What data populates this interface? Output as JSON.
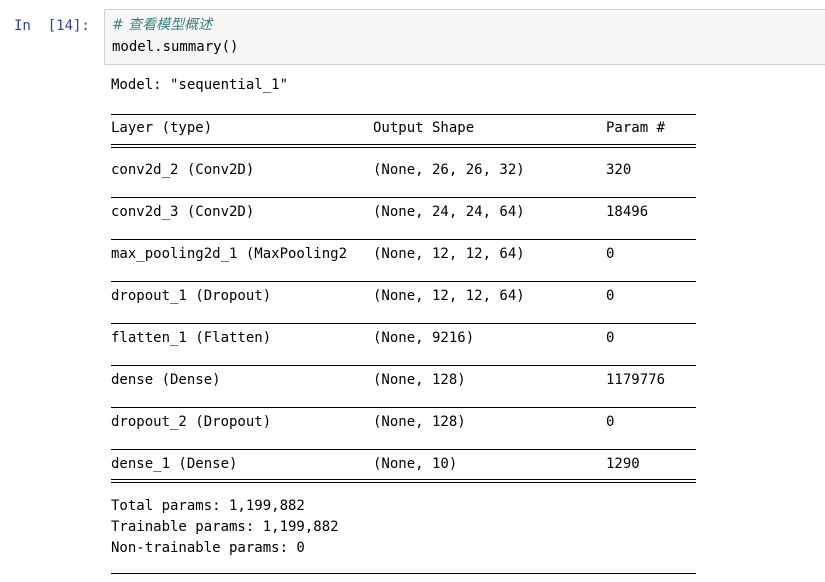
{
  "cell": {
    "prompt": "In  [14]:",
    "code_comment": "# 查看模型概述",
    "code_line": "model.summary()"
  },
  "output": {
    "model_title": "Model: \"sequential_1\"",
    "header": {
      "layer": "Layer (type)",
      "shape": "Output Shape",
      "param": "Param #"
    },
    "rows": [
      {
        "layer": "conv2d_2 (Conv2D)",
        "shape": "(None, 26, 26, 32)",
        "param": "320"
      },
      {
        "layer": "conv2d_3 (Conv2D)",
        "shape": "(None, 24, 24, 64)",
        "param": "18496"
      },
      {
        "layer": "max_pooling2d_1 (MaxPooling2",
        "shape": "(None, 12, 12, 64)",
        "param": "0"
      },
      {
        "layer": "dropout_1 (Dropout)",
        "shape": "(None, 12, 12, 64)",
        "param": "0"
      },
      {
        "layer": "flatten_1 (Flatten)",
        "shape": "(None, 9216)",
        "param": "0"
      },
      {
        "layer": "dense (Dense)",
        "shape": "(None, 128)",
        "param": "1179776"
      },
      {
        "layer": "dropout_2 (Dropout)",
        "shape": "(None, 128)",
        "param": "0"
      },
      {
        "layer": "dense_1 (Dense)",
        "shape": "(None, 10)",
        "param": "1290"
      }
    ],
    "totals": {
      "total": "Total params: 1,199,882",
      "trainable": "Trainable params: 1,199,882",
      "non_trainable": "Non-trainable params: 0"
    }
  },
  "colors": {
    "prompt": "#303f9f",
    "comment": "#408080",
    "input_bg": "#f7f7f7",
    "input_border": "#cfcfcf"
  }
}
